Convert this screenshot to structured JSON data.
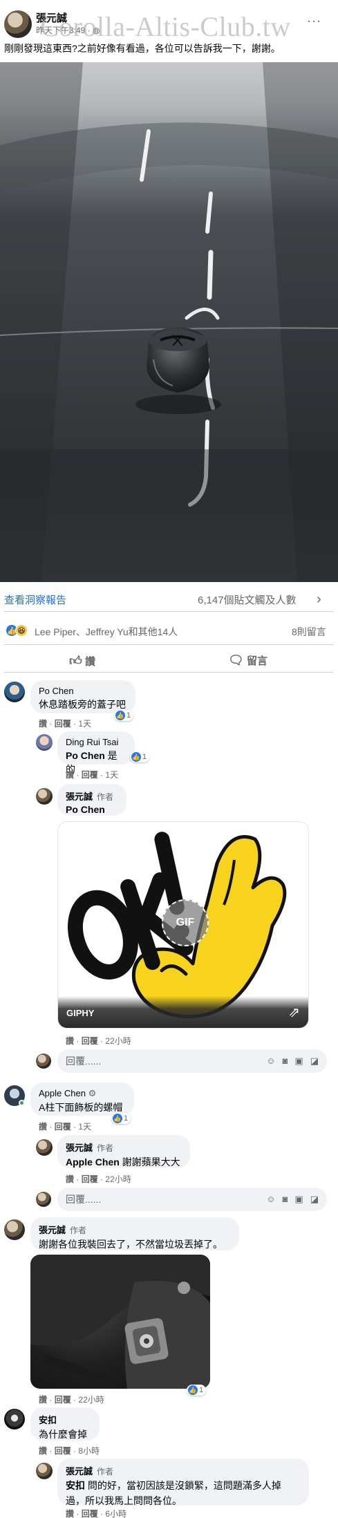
{
  "post": {
    "author": "張元誠",
    "time": "昨天下午3:49",
    "privacy_icon": "globe-icon",
    "more_label": "···",
    "watermark": "Corolla-Altis-Club.tw",
    "text": "剛剛發現這東西?之前好像有看過，各位可以告訴我一下，謝謝。"
  },
  "insights": {
    "link_label": "查看洞察報告",
    "reach_label": "6,147個貼文觸及人數"
  },
  "reactions": {
    "names": "Lee Piper、Jeffrey Yu和其他14人",
    "comments_count": "8則留言",
    "like_emoji": "👍",
    "haha_emoji": "😆"
  },
  "actions": {
    "like_label": "讚",
    "comment_label": "留言"
  },
  "comment_actions": {
    "like": "讚",
    "reply": "回覆",
    "sep": "·"
  },
  "reply_placeholder": "回覆......",
  "comments": [
    {
      "name": "Po Chen",
      "text": "休息踏板旁的蓋子吧",
      "time": "1天",
      "likes": "1",
      "replies": [
        {
          "name": "Ding Rui Tsai",
          "mention": "Po Chen",
          "text": "是的",
          "time": "1天",
          "likes": "1"
        },
        {
          "name": "張元誠",
          "author_tag": "作者",
          "mention": "Po Chen",
          "text": "",
          "time": "22小時",
          "gif_provider": "GIPHY",
          "gif_badge": "GIF",
          "gif_text": "OK!"
        }
      ]
    },
    {
      "name": "Apple Chen",
      "text": "A柱下面飾板的螺帽",
      "time": "1天",
      "likes": "1",
      "replies": [
        {
          "name": "張元誠",
          "author_tag": "作者",
          "mention": "Apple Chen",
          "text": "謝謝蘋果大大",
          "time": "22小時"
        }
      ]
    },
    {
      "name": "張元誠",
      "author_tag": "作者",
      "text": "謝謝各位我裝回去了，不然當垃圾丟掉了。",
      "time": "22小時",
      "likes": "1"
    },
    {
      "name": "安扣",
      "text": "為什麼會掉",
      "time": "8小時",
      "replies": [
        {
          "name": "張元誠",
          "author_tag": "作者",
          "mention": "安扣",
          "text_line1": "問的好，當初因該是沒鎖緊，這問題滿多人掉",
          "text_line2": "過，所以我馬上問問各位。",
          "time": "6小時"
        }
      ]
    }
  ],
  "colors": {
    "link_blue": "#216fdb",
    "like_blue": "#2078f4",
    "gif_yellow": "#f7d31e",
    "bubble_bg": "#f0f2f5"
  }
}
